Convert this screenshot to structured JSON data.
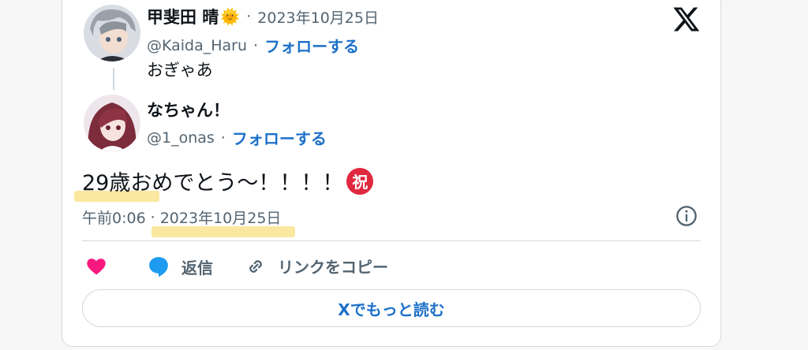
{
  "reply_to": {
    "display_name": "甲斐田 晴",
    "emoji": "🌞",
    "date": "2023年10月25日",
    "handle": "@Kaida_Haru",
    "follow_label": "フォローする",
    "text": "おぎゃあ"
  },
  "tweet": {
    "display_name": "なちゃん！",
    "handle": "@1_onas",
    "follow_label": "フォローする",
    "text": "29歳おめでとう〜！！！！",
    "badge": "祝",
    "time": "午前0:06",
    "date": "2023年10月25日"
  },
  "actions": {
    "reply_label": "返信",
    "copy_link_label": "リンクをコピー"
  },
  "read_more_label": "Xでもっと読む",
  "separator": "·",
  "colors": {
    "accent_blue": "#1d70c9",
    "like_pink": "#f91880",
    "reply_blue": "#1d9bf0",
    "badge_red": "#e0283f",
    "highlight": "#fbe79b"
  }
}
